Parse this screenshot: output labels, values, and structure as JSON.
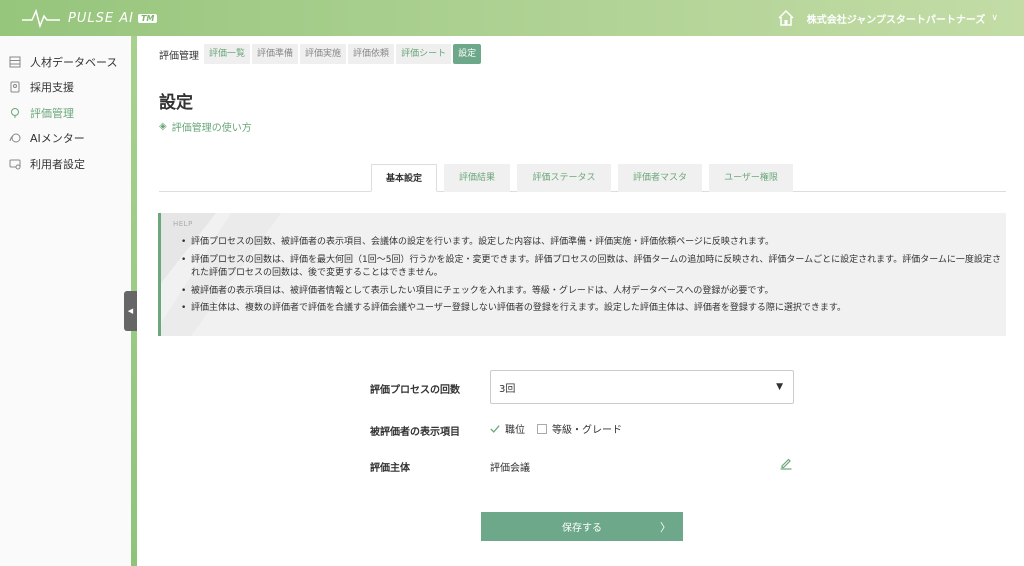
{
  "app": {
    "logo_text": "PULSE AI",
    "logo_tm": "TM",
    "company": "株式会社ジャンプスタートパートナーズ",
    "company_caret": "∨"
  },
  "sidebar": {
    "items": [
      {
        "label": "人材データベース",
        "icon": "database-icon"
      },
      {
        "label": "採用支援",
        "icon": "recruit-icon"
      },
      {
        "label": "評価管理",
        "icon": "evaluation-icon",
        "active": true
      },
      {
        "label": "AIメンター",
        "icon": "mentor-icon"
      },
      {
        "label": "利用者設定",
        "icon": "user-settings-icon"
      }
    ],
    "collapse_arrow": "◀"
  },
  "breadcrumb": {
    "home": "評価管理",
    "items": [
      "評価一覧",
      "評価準備",
      "評価実施",
      "評価依頼",
      "評価シート",
      "設定"
    ]
  },
  "page": {
    "title": "設定",
    "guide_link": "評価管理の使い方",
    "guide_icon": "◈"
  },
  "tabs": [
    "基本設定",
    "評価結果",
    "評価ステータス",
    "評価者マスタ",
    "ユーザー権限"
  ],
  "help": {
    "label": "HELP",
    "items": [
      "評価プロセスの回数、被評価者の表示項目、会議体の設定を行います。設定した内容は、評価準備・評価実施・評価依頼ページに反映されます。",
      "評価プロセスの回数は、評価を最大何回（1回〜5回）行うかを設定・変更できます。評価プロセスの回数は、評価タームの追加時に反映され、評価タームごとに設定されます。評価タームに一度設定された評価プロセスの回数は、後で変更することはできません。",
      "被評価者の表示項目は、被評価者情報として表示したい項目にチェックを入れます。等級・グレードは、人材データベースへの登録が必要です。",
      "評価主体は、複数の評価者で評価を合議する評価会議やユーザー登録しない評価者の登録を行えます。設定した評価主体は、評価者を登録する際に選択できます。"
    ]
  },
  "form": {
    "process_count_label": "評価プロセスの回数",
    "process_count_value": "3回",
    "select_caret": "▼",
    "display_items_label": "被評価者の表示項目",
    "display_items": [
      {
        "label": "職位",
        "checked": true
      },
      {
        "label": "等級・グレード",
        "checked": false
      }
    ],
    "entity_label": "評価主体",
    "entity_value": "評価会議"
  },
  "save_button": {
    "label": "保存する",
    "chevron": "〉"
  },
  "colors": {
    "accent": "#6ba77a",
    "button": "#6da88a",
    "header_start": "#96c57c",
    "header_end": "#c3dca6"
  }
}
